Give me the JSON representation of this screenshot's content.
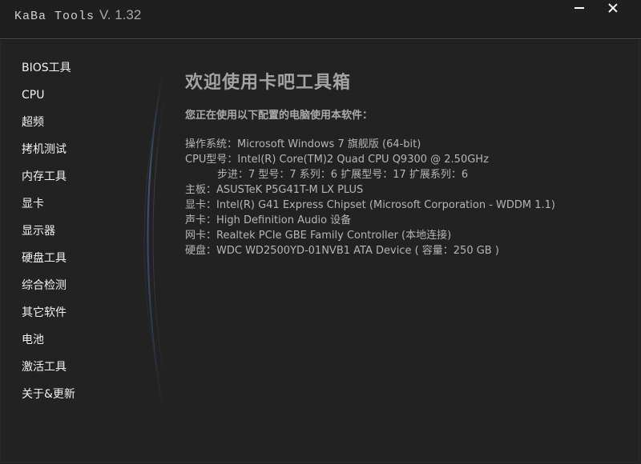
{
  "titlebar": {
    "app_name": "KaBa Tools",
    "version": "V. 1.32"
  },
  "sidebar": {
    "items": [
      {
        "label": "BIOS工具"
      },
      {
        "label": "CPU"
      },
      {
        "label": "超频"
      },
      {
        "label": "拷机测试"
      },
      {
        "label": "内存工具"
      },
      {
        "label": "显卡"
      },
      {
        "label": "显示器"
      },
      {
        "label": "硬盘工具"
      },
      {
        "label": "综合检测"
      },
      {
        "label": "其它软件"
      },
      {
        "label": "电池"
      },
      {
        "label": "激活工具"
      },
      {
        "label": "关于&更新"
      }
    ]
  },
  "main": {
    "title": "欢迎使用卡吧工具箱",
    "subtitle": "您正在使用以下配置的电脑使用本软件：",
    "info_lines": [
      "操作系统：Microsoft Windows 7 旗舰版 (64-bit)",
      "CPU型号：Intel(R) Core(TM)2 Quad CPU Q9300 @ 2.50GHz",
      "步进：7 型号：7 系列：6 扩展型号：17 扩展系列：6",
      "主板：ASUSTeK P5G41T-M LX PLUS",
      "显卡：Intel(R) G41 Express Chipset (Microsoft Corporation - WDDM 1.1)",
      "声卡：High Definition Audio 设备",
      "网卡：Realtek PCIe GBE Family Controller (本地连接)",
      "硬盘：WDC WD2500YD-01NVB1 ATA Device ( 容量：250 GB )"
    ]
  },
  "colors": {
    "background": "#222222",
    "titlebar": "#1f1f1f",
    "accent_glow": "#4a6fa5"
  }
}
